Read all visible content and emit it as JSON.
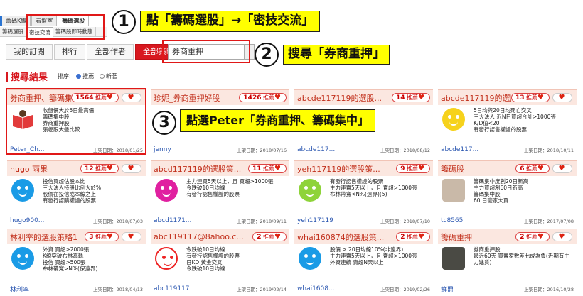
{
  "tabs_top": [
    "籌碼K線",
    "看盤室",
    "籌碼選股"
  ],
  "tabs_sub": [
    "籌碼選股",
    "密技交流",
    "籌碼股即時動態"
  ],
  "annotations": [
    {
      "num": "1",
      "text": "點「籌碼選股」→「密技交流」"
    },
    {
      "num": "2",
      "text": "搜尋「券商重押」"
    },
    {
      "num": "3",
      "text": "點選Peter「券商重押、籌碼集中」"
    }
  ],
  "nav": [
    "我的訂閱",
    "排行",
    "全部作者",
    "全部策略"
  ],
  "search": {
    "value": "券商重押"
  },
  "results": {
    "title": "搜尋結果",
    "sort_label": "排序:",
    "opt1": "推薦",
    "opt2": "新著"
  },
  "badge_suffix": "推薦",
  "date_prefix": "上架日期：",
  "cards": [
    {
      "title": "券商重押、籌碼集中",
      "count": "1564",
      "desc": "收盤價大於5日最高價\n籌碼集中股\n券商重押股\n張幅跟大盤比較",
      "author": "Peter_Ch...",
      "date": "2018/01/25",
      "avatar": "book"
    },
    {
      "title": "珍妮_券商重押好股",
      "count": "1426",
      "desc": "",
      "author": "jenny",
      "date": "2018/07/16",
      "avatar": "none"
    },
    {
      "title": "abcde117119的選股...",
      "count": "14",
      "desc": "",
      "author": "abcde117...",
      "date": "2018/08/12",
      "avatar": "none"
    },
    {
      "title": "abcde117119的選股...",
      "count": "13",
      "desc": "5日均與20日均死亡交叉\n三大法人 近N日買超合計>1000張\nK/D值<20\n有發行認售權證的股票",
      "author": "abcde117...",
      "date": "2018/10/11",
      "avatar": "yellow"
    },
    {
      "title": "hugo 雨果",
      "count": "12",
      "desc": "投信買超佔股本比\n三大法人持股比例大於%\n股價在投信成本線之上\n有發行認購權證的股票",
      "author": "hugo900...",
      "date": "2018/07/03",
      "avatar": "blue"
    },
    {
      "title": "abcd117119的選股策...",
      "count": "11",
      "desc": "主力連買5天以上，且 買超>1000張\n今跌破10日均線\n有發行認售權證的股票",
      "author": "abcd1171...",
      "date": "2018/09/11",
      "avatar": "purple"
    },
    {
      "title": "yeh117119的選股策...",
      "count": "9",
      "desc": "有發行認售權證的股票\n主力連賣5天以上，且 賣超>1000張\n布林帶寬<N%(遠界)(5)",
      "author": "yeh117119",
      "date": "2018/07/10",
      "avatar": "green"
    },
    {
      "title": "籌碼股",
      "count": "6",
      "desc": "籌碼集中度創20日新高\n主力買超創60日新高\n籌碼集中股\n60 日豪家大買",
      "author": "tc8565",
      "date": "2017/07/08",
      "avatar": "photo"
    },
    {
      "title": "林利率的選股策略1",
      "count": "3",
      "desc": "外資 買超>2000張\nK線突破布林高軌\n投信 買超>500張\n布林帶寬>N%(保遠界)",
      "author": "林利率",
      "date": "2018/04/13",
      "avatar": "blue"
    },
    {
      "title": "abc119117@8ahoo.c...",
      "count": "2",
      "desc": "今跌破10日均線\n有發行認售權證的股票\n日KD 黃金交叉\n今跌破10日均線",
      "author": "abc119117",
      "date": "2019/02/14",
      "avatar": "red"
    },
    {
      "title": "whai160874的選股策...",
      "count": "2",
      "desc": "股價 > 20日均線10%(非遠界)\n主力連賣5天以上，且 賣超>1000張\n外資連續 賣超N天以上",
      "author": "whai1608...",
      "date": "2019/02/26",
      "avatar": "blue"
    },
    {
      "title": "籌碼重押",
      "count": "2",
      "desc": "券商重押股\n最近60天 買賣家數差七成為負(近期有主力進貨)",
      "author": "鮮爵",
      "date": "2016/10/28",
      "avatar": "dark"
    }
  ]
}
